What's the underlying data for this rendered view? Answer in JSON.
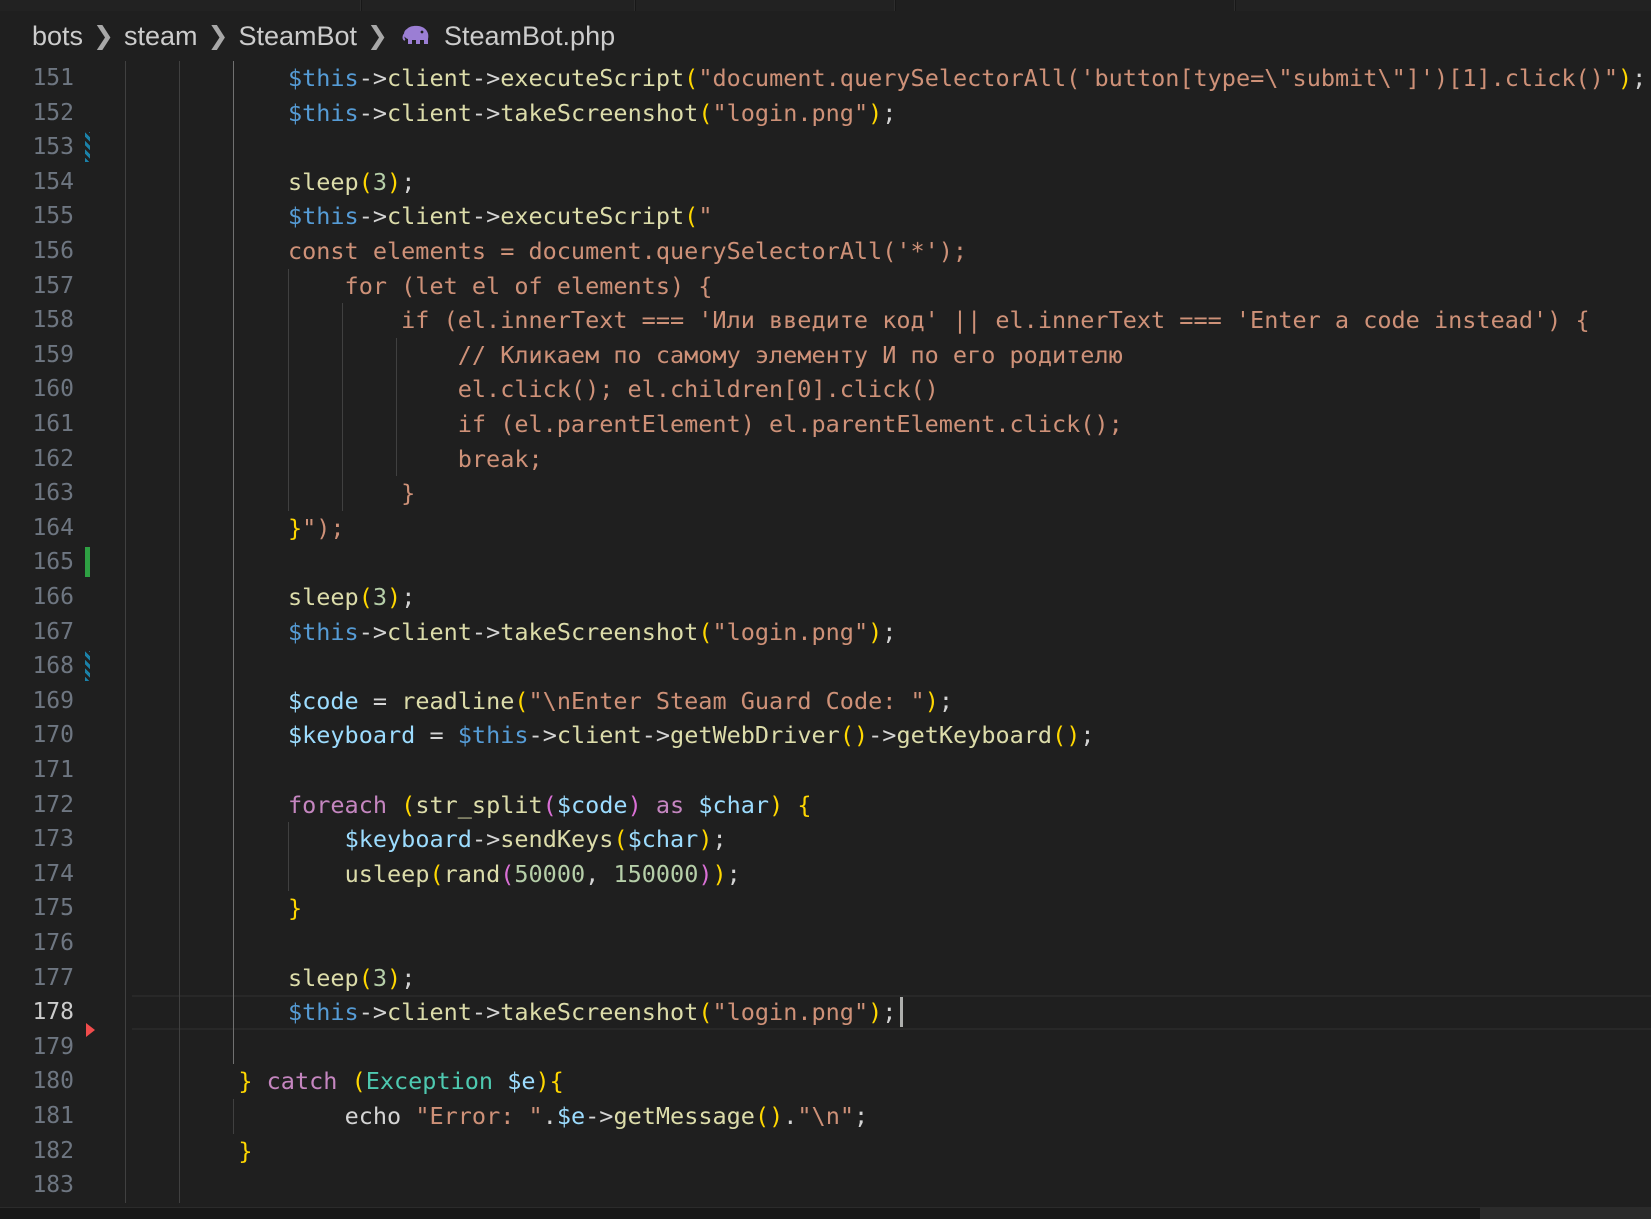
{
  "breadcrumb": {
    "items": [
      "bots",
      "steam",
      "SteamBot"
    ],
    "file": "SteamBot.php",
    "file_icon": "php-elephant-icon"
  },
  "editor": {
    "current_line": 178,
    "line_numbers": [
      "151",
      "152",
      "153",
      "154",
      "155",
      "156",
      "157",
      "158",
      "159",
      "160",
      "161",
      "162",
      "163",
      "164",
      "165",
      "166",
      "167",
      "168",
      "169",
      "170",
      "171",
      "172",
      "173",
      "174",
      "175",
      "176",
      "177",
      "178",
      "179",
      "180",
      "181",
      "182",
      "183"
    ],
    "lines": [
      "$this->client->executeScript(\"document.querySelectorAll('button[type=\\\"submit\\\"]')[1].click()\");",
      "$this->client->takeScreenshot(\"login.png\");",
      "",
      "sleep(3);",
      "$this->client->executeScript(\"",
      "const elements = document.querySelectorAll('*');",
      "    for (let el of elements) {",
      "        if (el.innerText === 'Или введите код' || el.innerText === 'Enter a code instead') {",
      "            // Кликаем по самому элементу И по его родителю",
      "            el.click(); el.children[0].click()",
      "            if (el.parentElement) el.parentElement.click();",
      "            break;",
      "        }",
      "}\");",
      "",
      "sleep(3);",
      "$this->client->takeScreenshot(\"login.png\");",
      "",
      "$code = readline(\"\\nEnter Steam Guard Code: \");",
      "$keyboard = $this->client->getWebDriver()->getKeyboard();",
      "",
      "foreach (str_split($code) as $char) {",
      "    $keyboard->sendKeys($char);",
      "    usleep(rand(50000, 150000));",
      "}",
      "",
      "sleep(3);",
      "$this->client->takeScreenshot(\"login.png\");",
      "",
      "} catch (Exception $e){",
      "    echo \"Error: \".$e->getMessage().\"\\n\";",
      "}",
      ""
    ]
  },
  "colors": {
    "background": "#1f1f1f",
    "variable": "#9cdcfe",
    "keyword": "#c586c0",
    "function": "#dcdcaa",
    "string": "#ce9178",
    "number": "#b5cea8",
    "comment": "#6a9955",
    "class": "#4ec9b0",
    "gutter_modified": "#1b81a8",
    "gutter_added": "#2ea043",
    "gutter_deleted": "#f14c4c"
  }
}
